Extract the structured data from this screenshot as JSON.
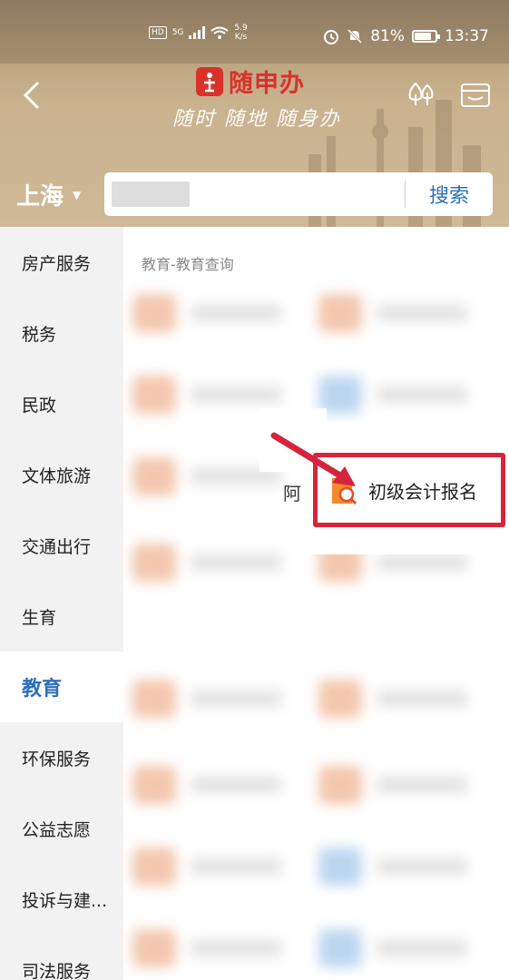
{
  "status_bar": {
    "net_badge": "HD",
    "signal": "5G",
    "speed_value": "5.9",
    "speed_unit": "K/s",
    "battery": "81%",
    "battery_level": 0.81,
    "time": "13:37"
  },
  "header": {
    "logo_text": "随申办",
    "slogan": "随时 随地 随身办",
    "city": "上海",
    "search_button": "搜索",
    "search_value": ""
  },
  "sidebar": {
    "items": [
      {
        "label": "房产服务"
      },
      {
        "label": "税务"
      },
      {
        "label": "民政"
      },
      {
        "label": "文体旅游"
      },
      {
        "label": "交通出行"
      },
      {
        "label": "生育"
      },
      {
        "label": "教育"
      },
      {
        "label": "环保服务"
      },
      {
        "label": "公益志愿"
      },
      {
        "label": "投诉与建..."
      },
      {
        "label": "司法服务"
      }
    ],
    "active_index": 6
  },
  "content": {
    "section_title": "教育-教育查询",
    "highlight_item": "初级会计报名",
    "partial_text": "阿"
  },
  "colors": {
    "accent_blue": "#2c6fb7",
    "highlight_red": "#d5243b",
    "brand_red": "#d9322b",
    "header_tan": "#c9b28e"
  }
}
